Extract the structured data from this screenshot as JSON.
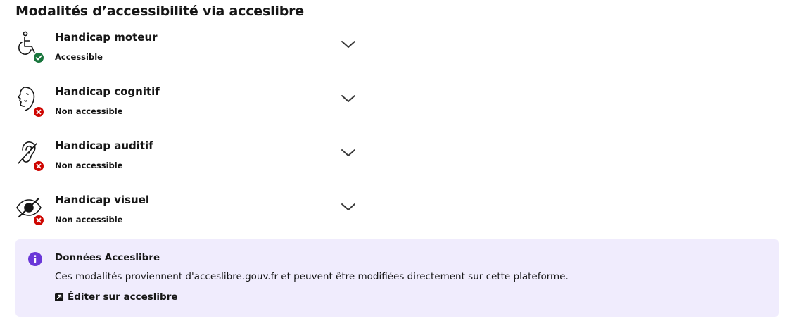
{
  "section": {
    "title": "Modalités d’accessibilité via acceslibre"
  },
  "items": [
    {
      "label": "Handicap moteur",
      "status": "Accessible",
      "icon": "wheelchair-icon",
      "status_icon": "check-circle-icon"
    },
    {
      "label": "Handicap cognitif",
      "status": "Non accessible",
      "icon": "face-profile-icon",
      "status_icon": "cross-circle-icon"
    },
    {
      "label": "Handicap auditif",
      "status": "Non accessible",
      "icon": "ear-crossed-icon",
      "status_icon": "cross-circle-icon"
    },
    {
      "label": "Handicap visuel",
      "status": "Non accessible",
      "icon": "eye-crossed-icon",
      "status_icon": "cross-circle-icon"
    }
  ],
  "info_box": {
    "icon": "info-icon",
    "title": "Données Acceslibre",
    "text": "Ces modalités proviennent d'acceslibre.gouv.fr et peuvent être modifiées directement sur cette plateforme.",
    "link_label": "Éditer sur acceslibre",
    "link_icon": "external-link-icon"
  },
  "colors": {
    "accessible": "#18753c",
    "not_accessible": "#ce0500",
    "info_bg": "#f0ecfd",
    "info_icon": "#6a37d8"
  }
}
